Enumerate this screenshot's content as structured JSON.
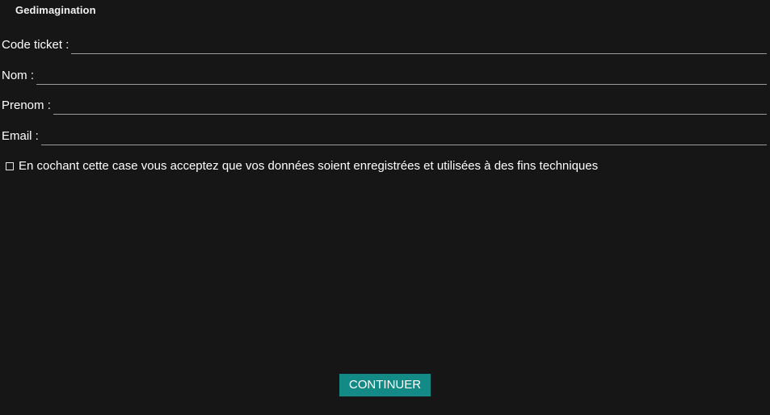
{
  "app": {
    "title": "Gedimagination"
  },
  "form": {
    "code_ticket": {
      "label": "Code ticket :",
      "value": ""
    },
    "nom": {
      "label": "Nom :",
      "value": ""
    },
    "prenom": {
      "label": "Prenom :",
      "value": ""
    },
    "email": {
      "label": "Email :",
      "value": ""
    },
    "consent": {
      "label": "En cochant cette case vous acceptez que vos données soient enregistrées et utilisées à des fins techniques",
      "checked": false
    },
    "continue_label": "CONTINUER"
  },
  "colors": {
    "background": "#161616",
    "accent": "#138a86",
    "underline": "#9a9a9a"
  }
}
